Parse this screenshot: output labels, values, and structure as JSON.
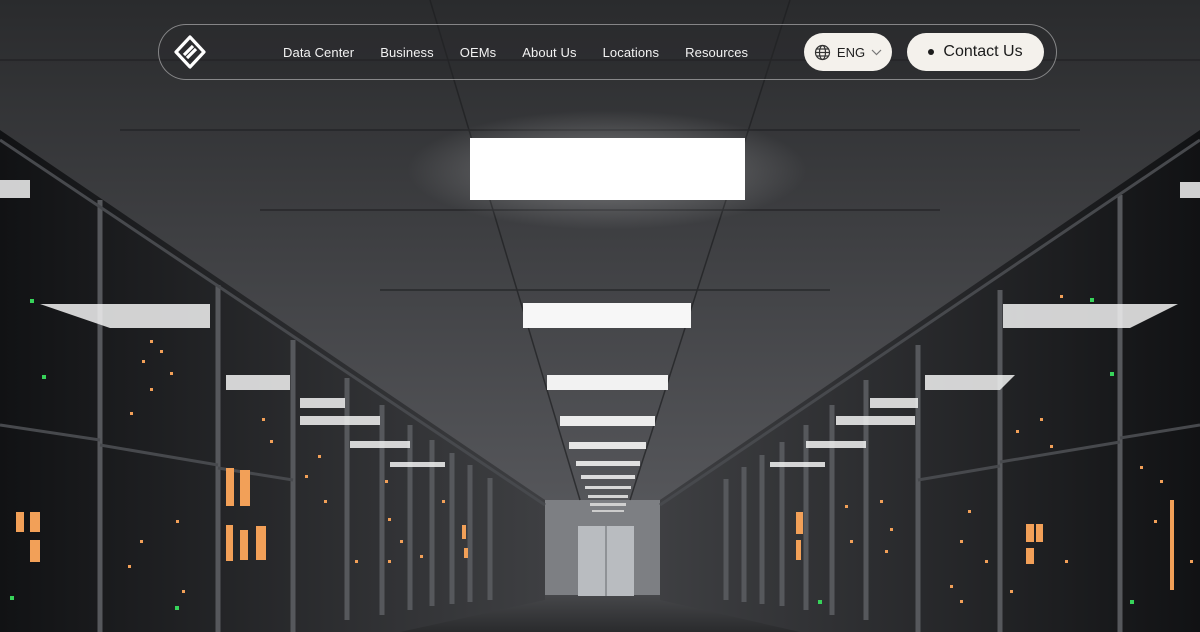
{
  "nav": {
    "logo": "brand-logo",
    "links": [
      {
        "label": "Data Center"
      },
      {
        "label": "Business"
      },
      {
        "label": "OEMs"
      },
      {
        "label": "About Us"
      },
      {
        "label": "Locations"
      },
      {
        "label": "Resources"
      }
    ],
    "language": {
      "label": "ENG",
      "icon": "globe-icon",
      "chevron": "chevron-down-icon"
    },
    "contact": {
      "label": "Contact Us"
    }
  },
  "hero": {
    "image": "data-center-server-corridor",
    "colors": {
      "accent_light": "#f4f1ec",
      "rack_glow": "#f2a058",
      "status_led": "#37d35a"
    }
  }
}
